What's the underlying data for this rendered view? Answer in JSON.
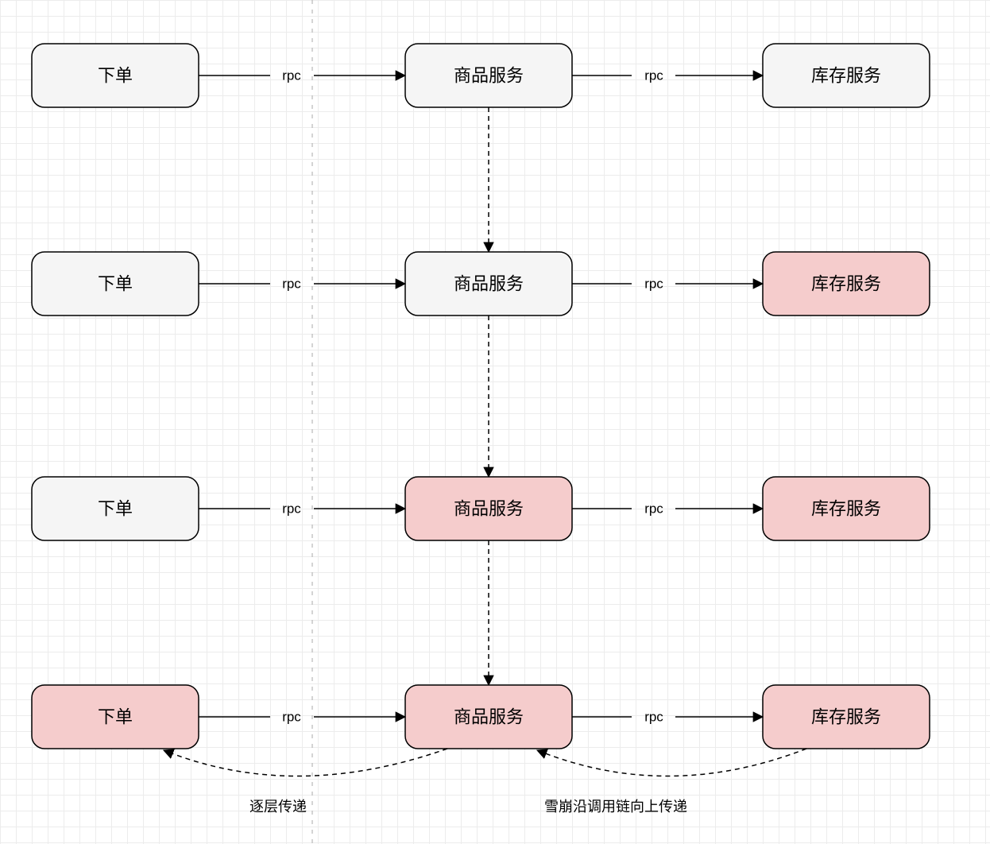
{
  "nodes": {
    "row1": {
      "order": "下单",
      "product": "商品服务",
      "stock": "库存服务"
    },
    "row2": {
      "order": "下单",
      "product": "商品服务",
      "stock": "库存服务"
    },
    "row3": {
      "order": "下单",
      "product": "商品服务",
      "stock": "库存服务"
    },
    "row4": {
      "order": "下单",
      "product": "商品服务",
      "stock": "库存服务"
    }
  },
  "edges": {
    "rpc": "rpc"
  },
  "captions": {
    "left": "逐层传递",
    "right": "雪崩沿调用链向上传递"
  },
  "states": {
    "row1": {
      "order": "normal",
      "product": "normal",
      "stock": "normal"
    },
    "row2": {
      "order": "normal",
      "product": "normal",
      "stock": "error"
    },
    "row3": {
      "order": "normal",
      "product": "error",
      "stock": "error"
    },
    "row4": {
      "order": "error",
      "product": "error",
      "stock": "error"
    }
  },
  "colors": {
    "normal": "#f5f5f5",
    "error": "#f5cccc"
  }
}
